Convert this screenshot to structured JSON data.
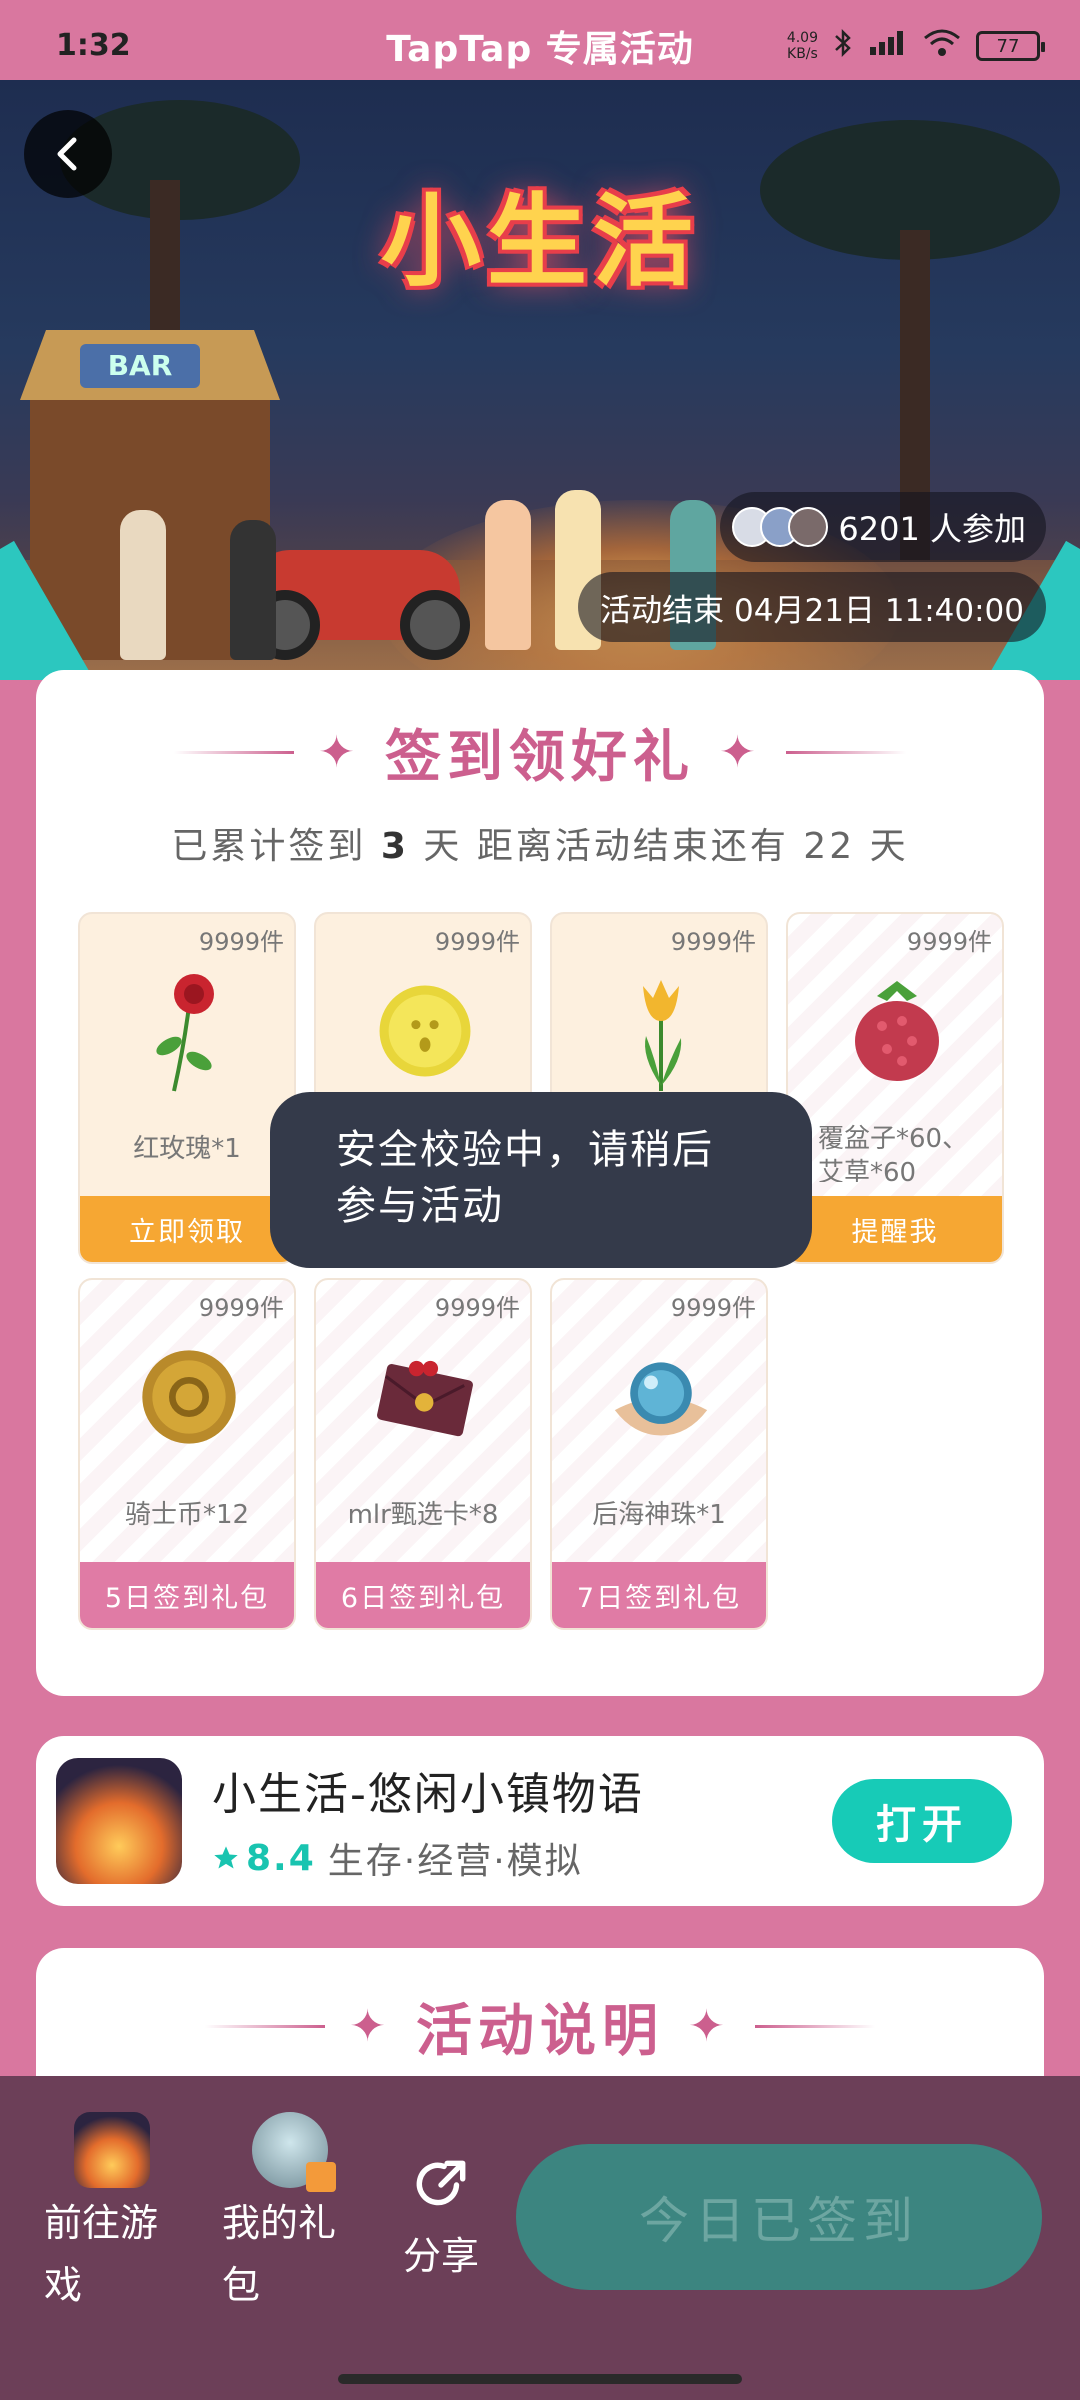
{
  "status_bar": {
    "time": "1:32",
    "title": "TapTap 专属活动",
    "net_speed": "4.09",
    "net_unit": "KB/s",
    "battery": "77"
  },
  "hero": {
    "logo_text": "小生活",
    "bar_sign": "BAR",
    "participants": "6201 人参加",
    "end_time": "活动结束 04月21日 11:40:00"
  },
  "checkin": {
    "title": "签到领好礼",
    "summary_prefix": "已累计签到",
    "days_signed": "3",
    "summary_mid": "天 距离活动结束还有",
    "days_left": "22",
    "summary_suffix": "天",
    "rewards": [
      {
        "count": "9999件",
        "name": "红玫瑰*1",
        "button": "立即领取",
        "icon": "rose-icon"
      },
      {
        "count": "9999件",
        "name": "",
        "button": "",
        "icon": "coin-icon"
      },
      {
        "count": "9999件",
        "name": "",
        "button": "",
        "icon": "tulip-icon"
      },
      {
        "count": "9999件",
        "name": "覆盆子*60、艾草*60",
        "button": "提醒我",
        "icon": "raspberry-icon"
      },
      {
        "count": "9999件",
        "name": "骑士币*12",
        "button": "5日签到礼包",
        "icon": "knight-coin-icon"
      },
      {
        "count": "9999件",
        "name": "mlr甄选卡*8",
        "button": "6日签到礼包",
        "icon": "envelope-icon"
      },
      {
        "count": "9999件",
        "name": "后海神珠*1",
        "button": "7日签到礼包",
        "icon": "pearl-icon"
      }
    ]
  },
  "toast": "安全校验中，请稍后参与活动",
  "app": {
    "name": "小生活-悠闲小镇物语",
    "rating": "8.4",
    "tags": "生存·经营·模拟",
    "open_button": "打开"
  },
  "description": {
    "title": "活动说明"
  },
  "bottom_bar": {
    "go_game": "前往游戏",
    "my_gifts": "我的礼包",
    "share": "分享",
    "signed_today": "今日已签到"
  },
  "colors": {
    "background_pink": "#d9779f",
    "accent_pink": "#cc5f8e",
    "orange": "#f6a733",
    "teal": "#17cbb7",
    "bottom_bar": "#6c3f58"
  }
}
